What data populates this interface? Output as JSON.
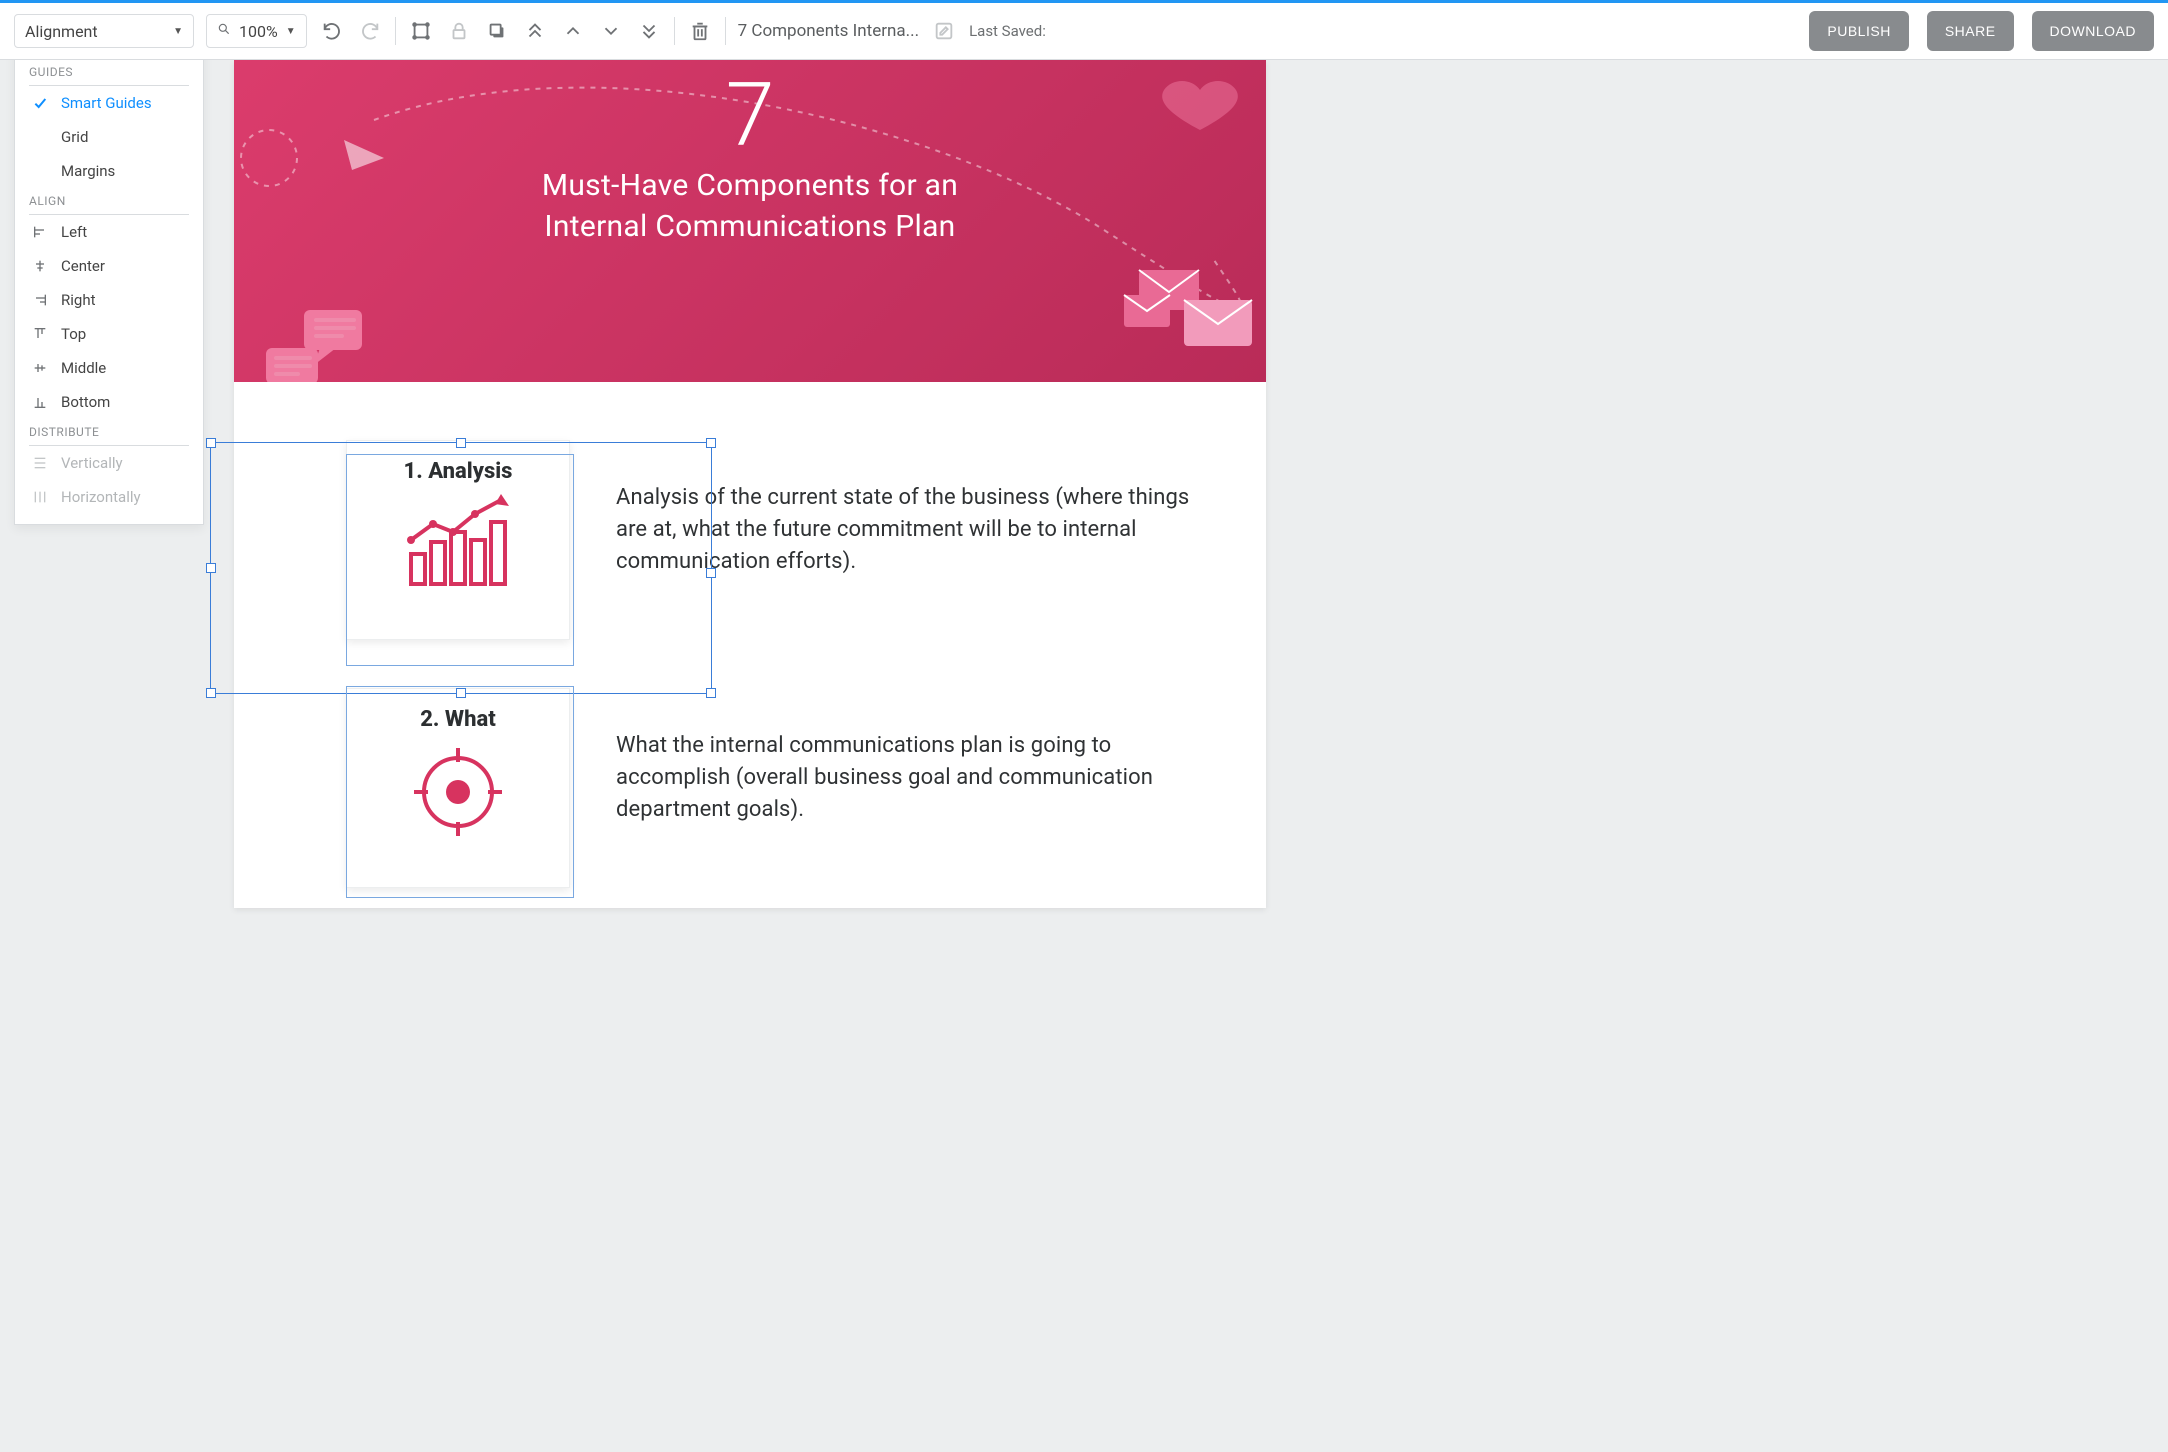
{
  "topbar": {
    "alignment_dropdown": "Alignment",
    "zoom_value": "100%",
    "doc_title": "7 Components Interna...",
    "last_saved_label": "Last Saved:",
    "publish": "PUBLISH",
    "share": "SHARE",
    "download": "DOWNLOAD"
  },
  "alignment_menu": {
    "section_guides": "GUIDES",
    "guide_smart": "Smart Guides",
    "guide_grid": "Grid",
    "guide_margins": "Margins",
    "section_align": "ALIGN",
    "align_left": "Left",
    "align_center": "Center",
    "align_right": "Right",
    "align_top": "Top",
    "align_middle": "Middle",
    "align_bottom": "Bottom",
    "section_distribute": "DISTRIBUTE",
    "dist_vertical": "Vertically",
    "dist_horizontal": "Horizontally"
  },
  "document": {
    "hero_number": "7",
    "hero_line1": "Must-Have Components for an",
    "hero_line2": "Internal Communications Plan",
    "sections": {
      "s1_title": "1. Analysis",
      "s1_desc": "Analysis of the current state of the business (where things are at, what the future commitment will be to internal communication efforts).",
      "s2_title": "2. What",
      "s2_desc": "What the internal communications plan is going to accomplish (overall business goal and communication department goals)."
    }
  }
}
